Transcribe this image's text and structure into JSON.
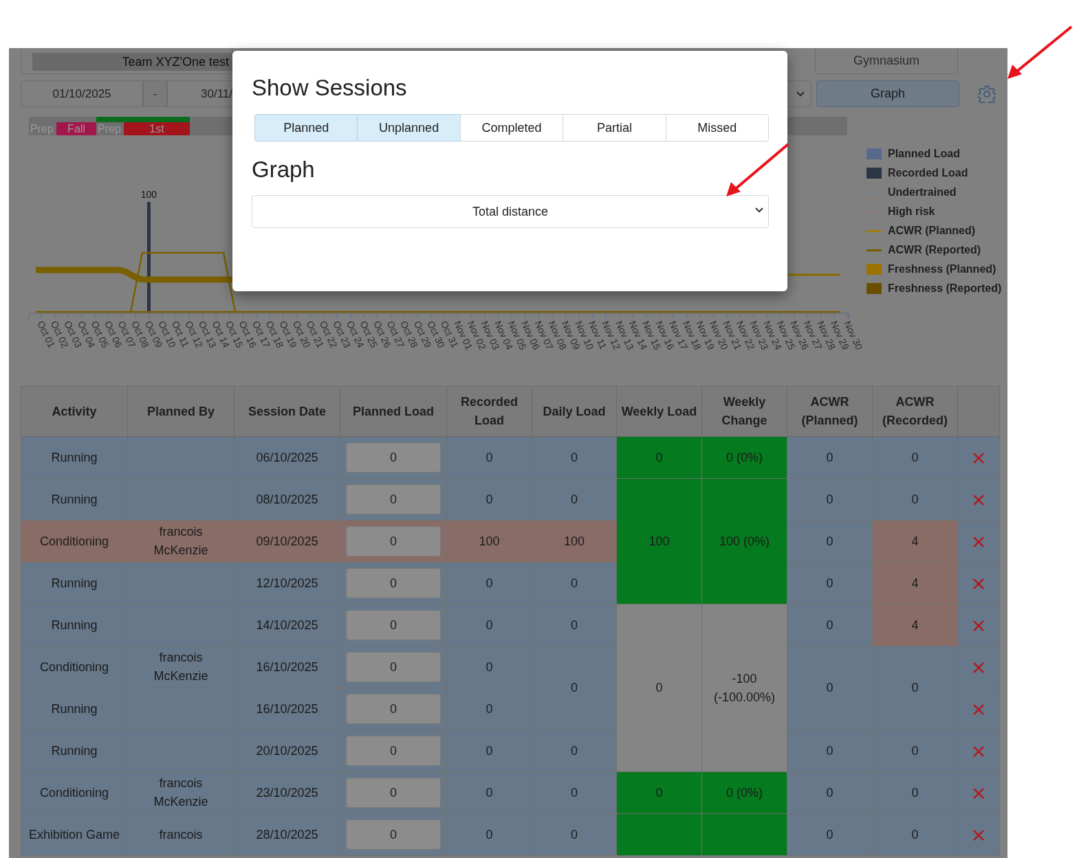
{
  "filters": {
    "team": "Team XYZ'One test",
    "location": "Gymnasium",
    "date_from": "01/10/2025",
    "date_separator": "-",
    "date_to": "30/11/",
    "graph_button": "Graph"
  },
  "phases": [
    {
      "label": "Prep"
    },
    {
      "label": "Fall",
      "color": "#a3164c"
    },
    {
      "label": "Prep",
      "marker": {
        "color": "#0b6b1e"
      }
    },
    {
      "label": "1st",
      "marker": {
        "color": "#0b6b1e"
      },
      "color": "#a3141c"
    }
  ],
  "chart": {
    "chart_data": {
      "type": "bar",
      "categories": [
        "Oct 01",
        "Oct 02",
        "Oct 03",
        "Oct 04",
        "Oct 05",
        "Oct 06",
        "Oct 07",
        "Oct 08",
        "Oct 09",
        "Oct 10",
        "Oct 11",
        "Oct 12",
        "Oct 13",
        "Oct 14",
        "Oct 15",
        "Oct 16",
        "Oct 17",
        "Oct 18",
        "Oct 19",
        "Oct 20",
        "Oct 21",
        "Oct 22",
        "Oct 23",
        "Oct 24",
        "Oct 25",
        "Oct 26",
        "Oct 27",
        "Oct 28",
        "Oct 29",
        "Oct 30",
        "Oct 31",
        "Nov 01",
        "Nov 02",
        "Nov 03",
        "Nov 04",
        "Nov 05",
        "Nov 06",
        "Nov 07",
        "Nov 08",
        "Nov 09",
        "Nov 10",
        "Nov 11",
        "Nov 12",
        "Nov 13",
        "Nov 14",
        "Nov 15",
        "Nov 16",
        "Nov 17",
        "Nov 18",
        "Nov 19",
        "Nov 20",
        "Nov 21",
        "Nov 22",
        "Nov 23",
        "Nov 24",
        "Nov 25",
        "Nov 26",
        "Nov 27",
        "Nov 28",
        "Nov 29",
        "Nov 30"
      ],
      "series": [
        {
          "name": "Recorded Load",
          "color": "#2b3546",
          "values": [
            null,
            null,
            null,
            null,
            null,
            null,
            null,
            null,
            100,
            null,
            null,
            null,
            null,
            null,
            null,
            null,
            null,
            null,
            null,
            null,
            null,
            null,
            null,
            null,
            null,
            null,
            null,
            null,
            null,
            null,
            null,
            null,
            null,
            null,
            null,
            null,
            null,
            null,
            null,
            null,
            null,
            null,
            null,
            null,
            null,
            null,
            null,
            null,
            null,
            null,
            null,
            null,
            null,
            null,
            null,
            null,
            null,
            null,
            null,
            null,
            null
          ]
        }
      ],
      "data_labels": true
    },
    "legend": [
      {
        "label": "Planned Load",
        "kind": "swatch",
        "color": "#56698a"
      },
      {
        "kind": "series"
      },
      {
        "label": "Undertrained",
        "kind": "dotted",
        "color": "#6d8599"
      },
      {
        "label": "High risk",
        "kind": "dotted",
        "color": "#9a7a76"
      },
      {
        "label": "ACWR (Planned)",
        "kind": "line",
        "color": "#a07d08"
      },
      {
        "label": "ACWR (Reported)",
        "kind": "line",
        "color": "#7a5c00"
      },
      {
        "label": "Freshness (Planned)",
        "kind": "swatch",
        "color": "#9a7300"
      },
      {
        "label": "Freshness (Reported)",
        "kind": "swatch",
        "color": "#6b4f00"
      }
    ]
  },
  "table": {
    "columns": [
      "Activity",
      "Planned By",
      "Session Date",
      "Planned Load",
      "Recorded Load",
      "Daily Load",
      "Weekly Load",
      "Weekly Change",
      "ACWR (Planned)",
      "ACWR (Recorded)"
    ],
    "rows": [
      {
        "flagged": false,
        "activity": "Running",
        "session_date": "06/10/2025",
        "planned_load": "0",
        "recorded_load": "0",
        "daily_load": "0",
        "weekly_load": {
          "text": "0",
          "color": "#057a1f"
        },
        "weekly_change": {
          "text": "0 (0%)",
          "color": "#057a1f"
        },
        "acwr_planned": "0",
        "acwr_recorded": "0"
      },
      {
        "flagged": false,
        "activity": "Running",
        "session_date": "08/10/2025",
        "planned_load": "0",
        "recorded_load": "0",
        "daily_load": "0",
        "weekly_load": {
          "text": "100",
          "color": "#057a1f"
        },
        "weekly_change": {
          "text": "100 (0%)",
          "color": "#057a1f"
        },
        "acwr_planned": "0",
        "acwr_recorded": "0"
      },
      {
        "flagged": true,
        "activity": "Conditioning",
        "planned_by": "francois McKenzie",
        "session_date": "09/10/2025",
        "planned_load": "0",
        "recorded_load": "100",
        "daily_load": "100",
        "acwr_planned": "0",
        "acwr_recorded": {
          "text": "4",
          "color": "#8a6c67"
        }
      },
      {
        "flagged": false,
        "activity": "Running",
        "session_date": "12/10/2025",
        "planned_load": "0",
        "recorded_load": "0",
        "daily_load": "0",
        "acwr_planned": "0",
        "acwr_recorded": {
          "text": "4",
          "color": "#8a6c67"
        }
      },
      {
        "flagged": false,
        "activity": "Running",
        "session_date": "14/10/2025",
        "planned_load": "0",
        "recorded_load": "0",
        "daily_load": "0",
        "weekly_load": {
          "text": "0",
          "color": "#858585"
        },
        "weekly_change": {
          "text": "-100 (-100.00%)",
          "color": "#858585"
        },
        "acwr_planned": "0",
        "acwr_recorded": {
          "text": "4",
          "color": "#8a6c67"
        }
      },
      {
        "flagged": false,
        "activity": "Conditioning",
        "planned_by": "francois McKenzie",
        "session_date": "16/10/2025",
        "planned_load": "0",
        "recorded_load": "0",
        "daily_load": "0",
        "acwr_planned": "0",
        "acwr_recorded": "0"
      },
      {
        "flagged": false,
        "activity": "Running",
        "session_date": "16/10/2025",
        "planned_load": "0",
        "recorded_load": "0"
      },
      {
        "flagged": false,
        "activity": "Running",
        "session_date": "20/10/2025",
        "planned_load": "0",
        "recorded_load": "0",
        "daily_load": "0",
        "acwr_planned": "0",
        "acwr_recorded": "0"
      },
      {
        "flagged": false,
        "activity": "Conditioning",
        "planned_by": "francois McKenzie",
        "session_date": "23/10/2025",
        "planned_load": "0",
        "recorded_load": "0",
        "daily_load": "0",
        "weekly_load": {
          "text": "0",
          "color": "#057a1f"
        },
        "weekly_change": {
          "text": "0 (0%)",
          "color": "#057a1f"
        },
        "acwr_planned": "0",
        "acwr_recorded": "0"
      },
      {
        "flagged": false,
        "activity": "Exhibition Game",
        "planned_by": "francois",
        "session_date": "28/10/2025",
        "planned_load": "0",
        "recorded_load": "0",
        "daily_load": "0",
        "weekly_load": {
          "color": "#057a1f"
        },
        "weekly_change": {
          "color": "#057a1f"
        },
        "acwr_planned": "0",
        "acwr_recorded": "0"
      }
    ]
  },
  "modal": {
    "title": "Show Sessions",
    "sessions": [
      {
        "label": "Planned",
        "selected": true
      },
      {
        "label": "Unplanned",
        "selected": true
      },
      {
        "label": "Completed",
        "selected": false
      },
      {
        "label": "Partial",
        "selected": false
      },
      {
        "label": "Missed",
        "selected": false
      }
    ],
    "graph_heading": "Graph",
    "graph_value": "Total distance"
  }
}
